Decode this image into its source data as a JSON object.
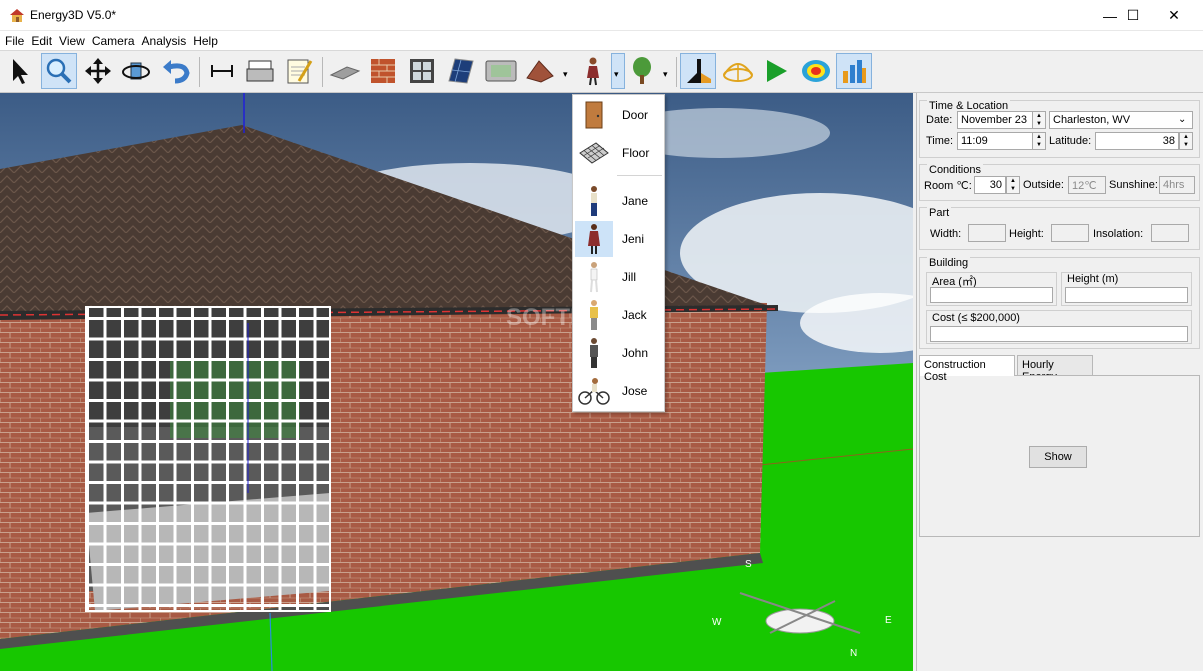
{
  "window": {
    "title": "Energy3D V5.0*",
    "min": "—",
    "max": "☐",
    "close": "✕"
  },
  "menu": [
    "File",
    "Edit",
    "View",
    "Camera",
    "Analysis",
    "Help"
  ],
  "toolbar": {
    "arrow_symbol": "▾"
  },
  "dropdown": {
    "items": [
      "Door",
      "Floor",
      "Jane",
      "Jeni",
      "Jill",
      "Jack",
      "John",
      "Jose"
    ],
    "selected": "Jeni"
  },
  "viewport": {
    "watermark": "SOFTPEDIA",
    "compass": [
      "N",
      "S",
      "E",
      "W"
    ]
  },
  "time_location": {
    "title": "Time & Location",
    "date_label": "Date:",
    "date_value": "November 23",
    "location_value": "Charleston, WV",
    "time_label": "Time:",
    "time_value": "11:09",
    "latitude_label": "Latitude:",
    "latitude_value": "38"
  },
  "conditions": {
    "title": "Conditions",
    "room_label": "Room ℃:",
    "room_value": "30",
    "outside_label": "Outside:",
    "outside_value": "12℃",
    "sunshine_label": "Sunshine:",
    "sunshine_value": "4hrs"
  },
  "part": {
    "title": "Part",
    "width_label": "Width:",
    "height_label": "Height:",
    "insolation_label": "Insolation:"
  },
  "building": {
    "title": "Building",
    "area_label": "Area (㎡)",
    "height_label": "Height (m)",
    "cost_label": "Cost (≤ $200,000)"
  },
  "tabs": [
    "Construction Cost",
    "Hourly Energy"
  ],
  "show_button": "Show"
}
